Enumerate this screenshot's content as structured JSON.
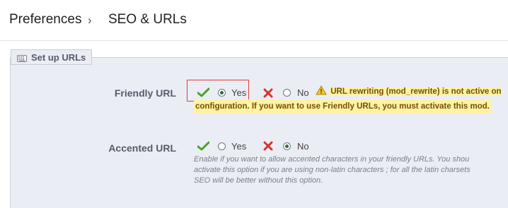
{
  "breadcrumb": {
    "root": "Preferences",
    "separator": "›",
    "page": "SEO & URLs"
  },
  "fieldset": {
    "legend": "Set up URLs",
    "legend_icon": "keyboard-icon"
  },
  "friendly_url": {
    "label": "Friendly URL",
    "yes_label": "Yes",
    "no_label": "No",
    "selected": "Yes",
    "warning_line1": "URL rewriting (mod_rewrite) is not active on y",
    "warning_line2": "configuration. If you want to use Friendly URLs, you must activate this mod."
  },
  "accented_url": {
    "label": "Accented URL",
    "yes_label": "Yes",
    "no_label": "No",
    "selected": "No",
    "help_line1": "Enable if you want to allow accented characters in your friendly URLs. You shou",
    "help_line2": "activate this option if you are using non-latin characters ; for all the latin charsets",
    "help_line3": "SEO will be better without this option."
  },
  "colors": {
    "check_green": "#4aa02c",
    "cross_red": "#d9322b",
    "highlight_box": "#e23a3a",
    "warning_bg": "#fdf3a4"
  }
}
